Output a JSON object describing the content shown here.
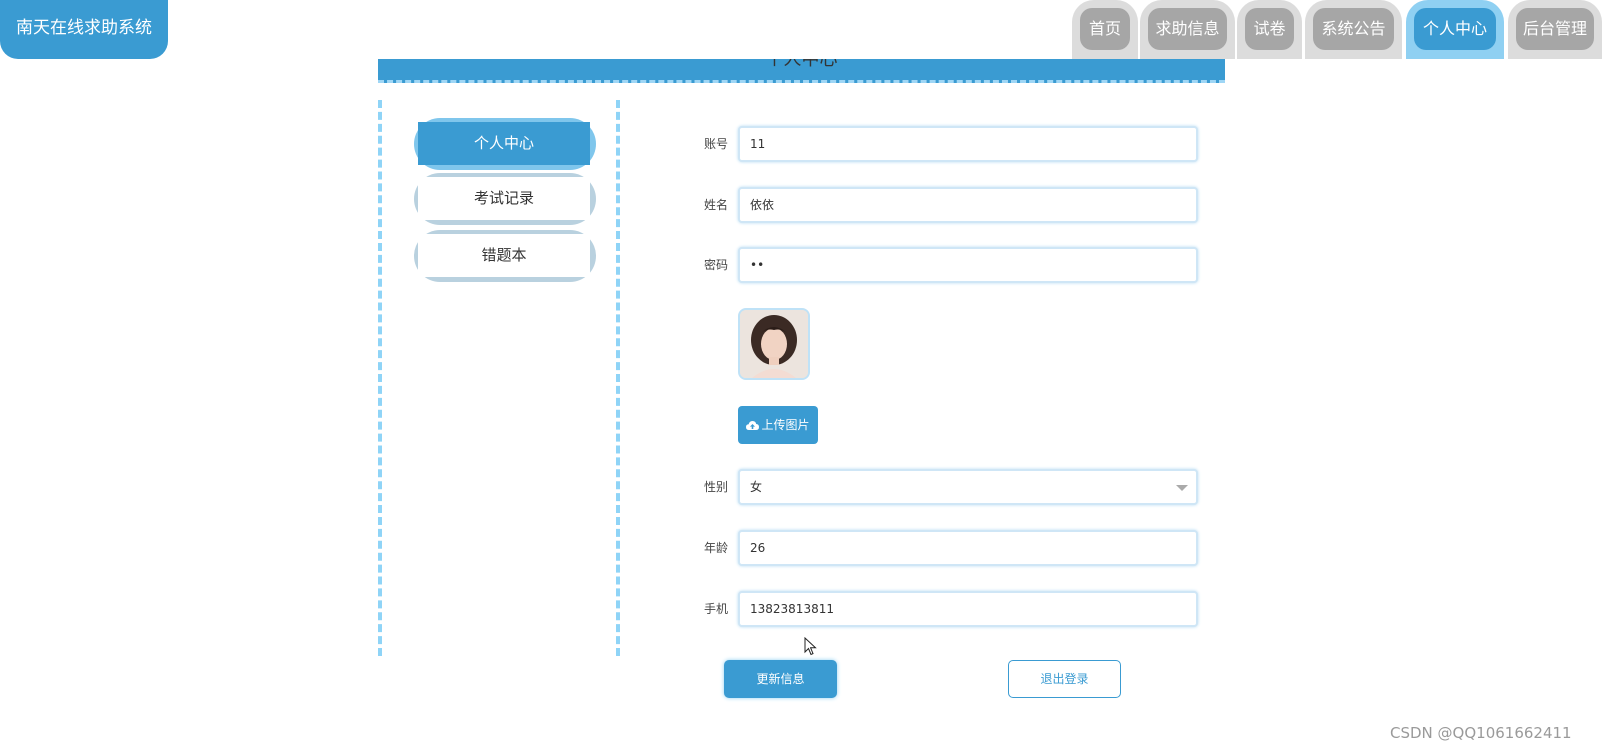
{
  "brand": {
    "title": "南天在线求助系统"
  },
  "nav": {
    "items": [
      {
        "label": "首页"
      },
      {
        "label": "求助信息"
      },
      {
        "label": "试卷"
      },
      {
        "label": "系统公告"
      },
      {
        "label": "个人中心"
      },
      {
        "label": "后台管理"
      }
    ],
    "active_item": "个人中心"
  },
  "banner": {
    "title": "个人中心"
  },
  "side_menu": {
    "items": [
      {
        "label": "个人中心"
      },
      {
        "label": "考试记录"
      },
      {
        "label": "错题本"
      }
    ],
    "active_item": "个人中心"
  },
  "form": {
    "account": {
      "label": "账号",
      "value": "11"
    },
    "name": {
      "label": "姓名",
      "value": "依依"
    },
    "password": {
      "label": "密码",
      "value": "••"
    },
    "avatar": {
      "icon": "profile-photo"
    },
    "upload": {
      "label": "上传图片",
      "icon": "cloud-upload-icon"
    },
    "gender": {
      "label": "性别",
      "value": "女"
    },
    "age": {
      "label": "年龄",
      "value": "26"
    },
    "phone": {
      "label": "手机",
      "value": "13823813811"
    }
  },
  "actions": {
    "update": "更新信息",
    "logout": "退出登录"
  },
  "watermark": {
    "text": "CSDN @QQ1061662411"
  },
  "colors": {
    "accent": "#3a9bd2",
    "accent_light": "#8fd0f2",
    "tab_inactive": "#a6a6a6"
  }
}
